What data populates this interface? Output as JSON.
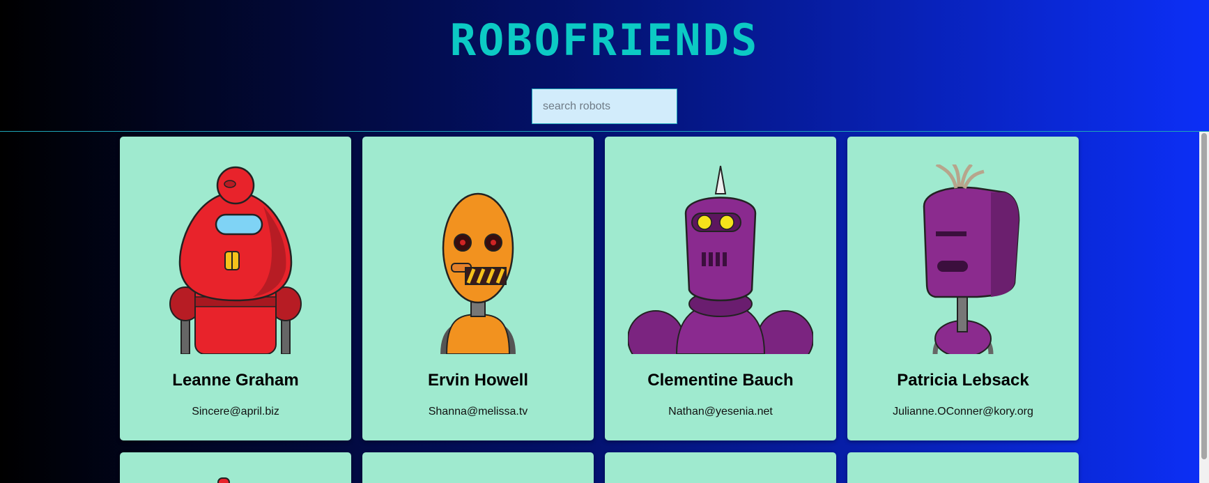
{
  "header": {
    "title": "ROBOFRIENDS"
  },
  "search": {
    "placeholder": "search robots",
    "value": ""
  },
  "robots": [
    {
      "name": "Leanne Graham",
      "email": "Sincere@april.biz",
      "color": "#e8232b"
    },
    {
      "name": "Ervin Howell",
      "email": "Shanna@melissa.tv",
      "color": "#f2921f"
    },
    {
      "name": "Clementine Bauch",
      "email": "Nathan@yesenia.net",
      "color": "#8a2a8f"
    },
    {
      "name": "Patricia Lebsack",
      "email": "Julianne.OConner@kory.org",
      "color": "#8b2b8e"
    }
  ],
  "colors": {
    "card": "#9feacf",
    "title": "#0ccac4",
    "search_bg": "#d2ecfb"
  }
}
